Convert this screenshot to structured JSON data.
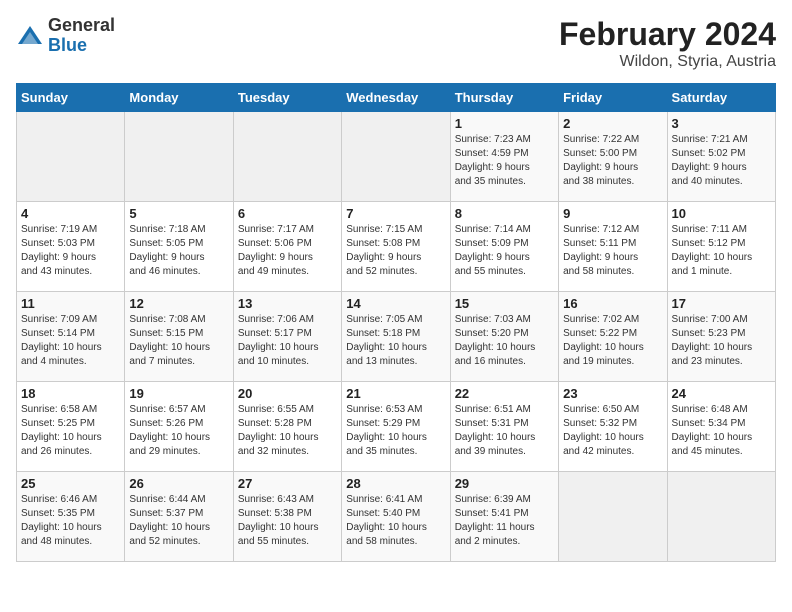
{
  "logo": {
    "general": "General",
    "blue": "Blue"
  },
  "title": "February 2024",
  "subtitle": "Wildon, Styria, Austria",
  "weekdays": [
    "Sunday",
    "Monday",
    "Tuesday",
    "Wednesday",
    "Thursday",
    "Friday",
    "Saturday"
  ],
  "weeks": [
    [
      {
        "day": "",
        "info": ""
      },
      {
        "day": "",
        "info": ""
      },
      {
        "day": "",
        "info": ""
      },
      {
        "day": "",
        "info": ""
      },
      {
        "day": "1",
        "info": "Sunrise: 7:23 AM\nSunset: 4:59 PM\nDaylight: 9 hours\nand 35 minutes."
      },
      {
        "day": "2",
        "info": "Sunrise: 7:22 AM\nSunset: 5:00 PM\nDaylight: 9 hours\nand 38 minutes."
      },
      {
        "day": "3",
        "info": "Sunrise: 7:21 AM\nSunset: 5:02 PM\nDaylight: 9 hours\nand 40 minutes."
      }
    ],
    [
      {
        "day": "4",
        "info": "Sunrise: 7:19 AM\nSunset: 5:03 PM\nDaylight: 9 hours\nand 43 minutes."
      },
      {
        "day": "5",
        "info": "Sunrise: 7:18 AM\nSunset: 5:05 PM\nDaylight: 9 hours\nand 46 minutes."
      },
      {
        "day": "6",
        "info": "Sunrise: 7:17 AM\nSunset: 5:06 PM\nDaylight: 9 hours\nand 49 minutes."
      },
      {
        "day": "7",
        "info": "Sunrise: 7:15 AM\nSunset: 5:08 PM\nDaylight: 9 hours\nand 52 minutes."
      },
      {
        "day": "8",
        "info": "Sunrise: 7:14 AM\nSunset: 5:09 PM\nDaylight: 9 hours\nand 55 minutes."
      },
      {
        "day": "9",
        "info": "Sunrise: 7:12 AM\nSunset: 5:11 PM\nDaylight: 9 hours\nand 58 minutes."
      },
      {
        "day": "10",
        "info": "Sunrise: 7:11 AM\nSunset: 5:12 PM\nDaylight: 10 hours\nand 1 minute."
      }
    ],
    [
      {
        "day": "11",
        "info": "Sunrise: 7:09 AM\nSunset: 5:14 PM\nDaylight: 10 hours\nand 4 minutes."
      },
      {
        "day": "12",
        "info": "Sunrise: 7:08 AM\nSunset: 5:15 PM\nDaylight: 10 hours\nand 7 minutes."
      },
      {
        "day": "13",
        "info": "Sunrise: 7:06 AM\nSunset: 5:17 PM\nDaylight: 10 hours\nand 10 minutes."
      },
      {
        "day": "14",
        "info": "Sunrise: 7:05 AM\nSunset: 5:18 PM\nDaylight: 10 hours\nand 13 minutes."
      },
      {
        "day": "15",
        "info": "Sunrise: 7:03 AM\nSunset: 5:20 PM\nDaylight: 10 hours\nand 16 minutes."
      },
      {
        "day": "16",
        "info": "Sunrise: 7:02 AM\nSunset: 5:22 PM\nDaylight: 10 hours\nand 19 minutes."
      },
      {
        "day": "17",
        "info": "Sunrise: 7:00 AM\nSunset: 5:23 PM\nDaylight: 10 hours\nand 23 minutes."
      }
    ],
    [
      {
        "day": "18",
        "info": "Sunrise: 6:58 AM\nSunset: 5:25 PM\nDaylight: 10 hours\nand 26 minutes."
      },
      {
        "day": "19",
        "info": "Sunrise: 6:57 AM\nSunset: 5:26 PM\nDaylight: 10 hours\nand 29 minutes."
      },
      {
        "day": "20",
        "info": "Sunrise: 6:55 AM\nSunset: 5:28 PM\nDaylight: 10 hours\nand 32 minutes."
      },
      {
        "day": "21",
        "info": "Sunrise: 6:53 AM\nSunset: 5:29 PM\nDaylight: 10 hours\nand 35 minutes."
      },
      {
        "day": "22",
        "info": "Sunrise: 6:51 AM\nSunset: 5:31 PM\nDaylight: 10 hours\nand 39 minutes."
      },
      {
        "day": "23",
        "info": "Sunrise: 6:50 AM\nSunset: 5:32 PM\nDaylight: 10 hours\nand 42 minutes."
      },
      {
        "day": "24",
        "info": "Sunrise: 6:48 AM\nSunset: 5:34 PM\nDaylight: 10 hours\nand 45 minutes."
      }
    ],
    [
      {
        "day": "25",
        "info": "Sunrise: 6:46 AM\nSunset: 5:35 PM\nDaylight: 10 hours\nand 48 minutes."
      },
      {
        "day": "26",
        "info": "Sunrise: 6:44 AM\nSunset: 5:37 PM\nDaylight: 10 hours\nand 52 minutes."
      },
      {
        "day": "27",
        "info": "Sunrise: 6:43 AM\nSunset: 5:38 PM\nDaylight: 10 hours\nand 55 minutes."
      },
      {
        "day": "28",
        "info": "Sunrise: 6:41 AM\nSunset: 5:40 PM\nDaylight: 10 hours\nand 58 minutes."
      },
      {
        "day": "29",
        "info": "Sunrise: 6:39 AM\nSunset: 5:41 PM\nDaylight: 11 hours\nand 2 minutes."
      },
      {
        "day": "",
        "info": ""
      },
      {
        "day": "",
        "info": ""
      }
    ]
  ]
}
